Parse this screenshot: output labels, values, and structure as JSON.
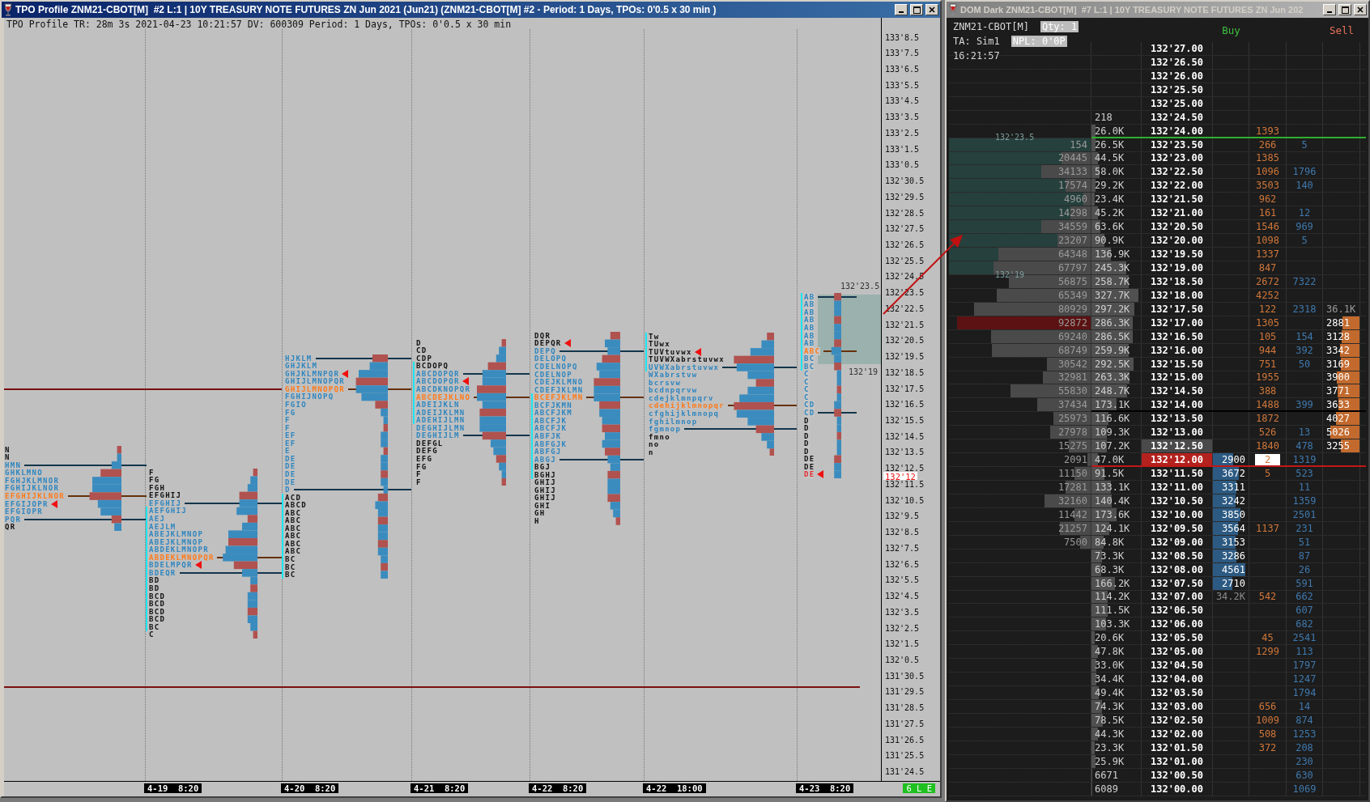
{
  "tpo_window": {
    "title": "TPO Profile ZNM21-CBOT[M]  #2 L:1 | 10Y TREASURY NOTE FUTURES ZN Jun 2021 (Jun21) (ZNM21-CBOT[M] #2 - Period: 1 Days, TPOs: 0'0.5 x 30 min )",
    "header": "TPO Profile TR: 28m 3s 2021-04-23 10:21:57 DV: 600309 Period: 1 Days, TPOs: 0'0.5 x 30 min",
    "price_axis": [
      "133'8.5",
      "133'7.5",
      "133'6.5",
      "133'5.5",
      "133'4.5",
      "133'3.5",
      "133'2.5",
      "133'1.5",
      "133'0.5",
      "132'30.5",
      "132'29.5",
      "132'28.5",
      "132'27.5",
      "132'26.5",
      "132'25.5",
      "132'24.5",
      "132'23.5",
      "132'22.5",
      "132'21.5",
      "132'20.5",
      "132'19.5",
      "132'18.5",
      "132'17.5",
      "132'16.5",
      "132'15.5",
      "132'14.5",
      "132'13.5",
      "132'12.5",
      "132'11.5",
      "132'10.5",
      "132'9.5",
      "132'8.5",
      "132'7.5",
      "132'6.5",
      "132'5.5",
      "132'4.5",
      "132'3.5",
      "132'2.5",
      "132'1.5",
      "132'0.5",
      "131'30.5",
      "131'29.5",
      "131'28.5",
      "131'27.5",
      "131'26.5",
      "131'25.5",
      "131'24.5"
    ],
    "last_price_label": "132'12",
    "value_area_labels": [
      "132'23.5",
      "132'19"
    ],
    "status": "6 L E",
    "sessions": [
      {
        "profile": [
          {
            "text": "N",
            "color": "#111111",
            "ib": false,
            "arrow": false,
            "line": false
          },
          {
            "text": "N",
            "color": "#111111",
            "ib": false,
            "arrow": false,
            "line": false
          },
          {
            "text": "HMN",
            "color": "#2f86bf",
            "ib": false,
            "arrow": false,
            "line": true
          },
          {
            "text": "GHKLMNO",
            "color": "#2f86bf",
            "ib": false,
            "arrow": false,
            "line": false
          },
          {
            "text": "FGHJKLMNOR",
            "color": "#2f86bf",
            "ib": false,
            "arrow": false,
            "line": false
          },
          {
            "text": "FGHIJKLNOR",
            "color": "#2f86bf",
            "ib": false,
            "arrow": false,
            "line": false
          },
          {
            "text": "EFGHIJKLNOR",
            "color": "#ff7a1a",
            "ib": false,
            "arrow": false,
            "line": true
          },
          {
            "text": "EFGIJOPR",
            "color": "#2f86bf",
            "ib": false,
            "arrow": true,
            "line": false
          },
          {
            "text": "EFGIOPR",
            "color": "#2f86bf",
            "ib": false,
            "arrow": false,
            "line": false
          },
          {
            "text": "PQR",
            "color": "#2f86bf",
            "ib": false,
            "arrow": false,
            "line": true
          },
          {
            "text": "QR",
            "color": "#111111",
            "ib": false,
            "arrow": false,
            "line": false
          }
        ]
      },
      {
        "date": "4-19  8:20",
        "profile": [
          {
            "text": "F",
            "color": "#111111",
            "ib": false,
            "arrow": false,
            "line": false
          },
          {
            "text": "FG",
            "color": "#111111",
            "ib": false,
            "arrow": false,
            "line": false
          },
          {
            "text": "FGH",
            "color": "#111111",
            "ib": false,
            "arrow": false,
            "line": false
          },
          {
            "text": "EFGHIJ",
            "color": "#111111",
            "ib": false,
            "arrow": false,
            "line": false
          },
          {
            "text": "EFGHIJ",
            "color": "#2f86bf",
            "ib": false,
            "arrow": false,
            "line": true
          },
          {
            "text": "AEFGHIJ",
            "color": "#2f86bf",
            "ib": true,
            "arrow": false,
            "line": false
          },
          {
            "text": "AEJ",
            "color": "#2f86bf",
            "ib": true,
            "arrow": false,
            "line": false
          },
          {
            "text": "AEJLM",
            "color": "#2f86bf",
            "ib": true,
            "arrow": false,
            "line": false
          },
          {
            "text": "ABEJKLMNOP",
            "color": "#2f86bf",
            "ib": true,
            "arrow": false,
            "line": false
          },
          {
            "text": "ABEJKLMNOP",
            "color": "#2f86bf",
            "ib": true,
            "arrow": false,
            "line": false
          },
          {
            "text": "ABDEKLMNOPR",
            "color": "#2f86bf",
            "ib": true,
            "arrow": false,
            "line": false
          },
          {
            "text": "ABDEKLMNOPQR",
            "color": "#ff7a1a",
            "ib": true,
            "arrow": false,
            "line": true
          },
          {
            "text": "BDELMPQR",
            "color": "#2f86bf",
            "ib": true,
            "arrow": true,
            "line": false
          },
          {
            "text": "BDEQR",
            "color": "#2f86bf",
            "ib": true,
            "arrow": false,
            "line": true
          },
          {
            "text": "BD",
            "color": "#111111",
            "ib": true,
            "arrow": false,
            "line": false
          },
          {
            "text": "BD",
            "color": "#111111",
            "ib": true,
            "arrow": false,
            "line": false
          },
          {
            "text": "BCD",
            "color": "#111111",
            "ib": true,
            "arrow": false,
            "line": false
          },
          {
            "text": "BCD",
            "color": "#111111",
            "ib": true,
            "arrow": false,
            "line": false
          },
          {
            "text": "BCD",
            "color": "#111111",
            "ib": true,
            "arrow": false,
            "line": false
          },
          {
            "text": "BCD",
            "color": "#111111",
            "ib": true,
            "arrow": false,
            "line": false
          },
          {
            "text": "BC",
            "color": "#111111",
            "ib": true,
            "arrow": false,
            "line": false
          },
          {
            "text": "C",
            "color": "#111111",
            "ib": false,
            "arrow": false,
            "line": false
          }
        ]
      },
      {
        "date": "4-20  8:20",
        "profile": [
          {
            "text": "HJKLM",
            "color": "#2f86bf",
            "ib": false,
            "arrow": false,
            "line": true
          },
          {
            "text": "GHJKLM",
            "color": "#2f86bf",
            "ib": false,
            "arrow": false,
            "line": false
          },
          {
            "text": "GHJKLMNPQR",
            "color": "#2f86bf",
            "ib": false,
            "arrow": true,
            "line": false
          },
          {
            "text": "GHIJLMNOPQR",
            "color": "#2f86bf",
            "ib": false,
            "arrow": false,
            "line": false
          },
          {
            "text": "GHIJLMNOPQR",
            "color": "#ff7a1a",
            "ib": false,
            "arrow": false,
            "line": true
          },
          {
            "text": "FGHIJNOPQ",
            "color": "#2f86bf",
            "ib": false,
            "arrow": false,
            "line": false
          },
          {
            "text": "FGIO",
            "color": "#2f86bf",
            "ib": false,
            "arrow": false,
            "line": false
          },
          {
            "text": "FG",
            "color": "#2f86bf",
            "ib": false,
            "arrow": false,
            "line": false
          },
          {
            "text": "F",
            "color": "#2f86bf",
            "ib": false,
            "arrow": false,
            "line": false
          },
          {
            "text": "F",
            "color": "#2f86bf",
            "ib": false,
            "arrow": false,
            "line": false
          },
          {
            "text": "EF",
            "color": "#2f86bf",
            "ib": false,
            "arrow": false,
            "line": false
          },
          {
            "text": "EF",
            "color": "#2f86bf",
            "ib": false,
            "arrow": false,
            "line": false
          },
          {
            "text": "E",
            "color": "#2f86bf",
            "ib": false,
            "arrow": false,
            "line": false
          },
          {
            "text": "DE",
            "color": "#2f86bf",
            "ib": false,
            "arrow": false,
            "line": false
          },
          {
            "text": "DE",
            "color": "#2f86bf",
            "ib": false,
            "arrow": false,
            "line": false
          },
          {
            "text": "DE",
            "color": "#2f86bf",
            "ib": false,
            "arrow": false,
            "line": false
          },
          {
            "text": "DE",
            "color": "#2f86bf",
            "ib": false,
            "arrow": false,
            "line": false
          },
          {
            "text": "D",
            "color": "#2f86bf",
            "ib": false,
            "arrow": false,
            "line": true
          },
          {
            "text": "ACD",
            "color": "#111111",
            "ib": true,
            "arrow": false,
            "line": false
          },
          {
            "text": "ABCD",
            "color": "#111111",
            "ib": true,
            "arrow": false,
            "line": false
          },
          {
            "text": "ABC",
            "color": "#111111",
            "ib": true,
            "arrow": false,
            "line": false
          },
          {
            "text": "ABC",
            "color": "#111111",
            "ib": true,
            "arrow": false,
            "line": false
          },
          {
            "text": "ABC",
            "color": "#111111",
            "ib": true,
            "arrow": false,
            "line": false
          },
          {
            "text": "ABC",
            "color": "#111111",
            "ib": true,
            "arrow": false,
            "line": false
          },
          {
            "text": "ABC",
            "color": "#111111",
            "ib": true,
            "arrow": false,
            "line": false
          },
          {
            "text": "ABC",
            "color": "#111111",
            "ib": true,
            "arrow": false,
            "line": false
          },
          {
            "text": "BC",
            "color": "#111111",
            "ib": true,
            "arrow": false,
            "line": false
          },
          {
            "text": "BC",
            "color": "#111111",
            "ib": true,
            "arrow": false,
            "line": false
          },
          {
            "text": "BC",
            "color": "#111111",
            "ib": true,
            "arrow": false,
            "line": false
          }
        ]
      },
      {
        "date": "4-21  8:20",
        "profile": [
          {
            "text": "D",
            "color": "#111111",
            "ib": false,
            "arrow": false,
            "line": false
          },
          {
            "text": "CD",
            "color": "#111111",
            "ib": false,
            "arrow": false,
            "line": false
          },
          {
            "text": "CDP",
            "color": "#111111",
            "ib": false,
            "arrow": false,
            "line": false
          },
          {
            "text": "BCDOPQ",
            "color": "#111111",
            "ib": true,
            "arrow": false,
            "line": false
          },
          {
            "text": "ABCDOPQR",
            "color": "#2f86bf",
            "ib": true,
            "arrow": false,
            "line": true
          },
          {
            "text": "ABCDOPQR",
            "color": "#2f86bf",
            "ib": true,
            "arrow": true,
            "line": false
          },
          {
            "text": "ABCDKNOPQR",
            "color": "#2f86bf",
            "ib": true,
            "arrow": false,
            "line": false
          },
          {
            "text": "ABCDEJKLNO",
            "color": "#ff7a1a",
            "ib": true,
            "arrow": false,
            "line": true
          },
          {
            "text": "ADEIJKLN",
            "color": "#2f86bf",
            "ib": true,
            "arrow": false,
            "line": false
          },
          {
            "text": "ADEIJKLMN",
            "color": "#2f86bf",
            "ib": true,
            "arrow": false,
            "line": false
          },
          {
            "text": "ADEHIJLMN",
            "color": "#2f86bf",
            "ib": true,
            "arrow": false,
            "line": false
          },
          {
            "text": "DEGHIJLMN",
            "color": "#2f86bf",
            "ib": false,
            "arrow": false,
            "line": false
          },
          {
            "text": "DEGHIJLM",
            "color": "#2f86bf",
            "ib": false,
            "arrow": false,
            "line": true
          },
          {
            "text": "DEFGL",
            "color": "#111111",
            "ib": false,
            "arrow": false,
            "line": false
          },
          {
            "text": "DEFG",
            "color": "#111111",
            "ib": false,
            "arrow": false,
            "line": false
          },
          {
            "text": "EFG",
            "color": "#111111",
            "ib": false,
            "arrow": false,
            "line": false
          },
          {
            "text": "FG",
            "color": "#111111",
            "ib": false,
            "arrow": false,
            "line": false
          },
          {
            "text": "F",
            "color": "#111111",
            "ib": false,
            "arrow": false,
            "line": false
          },
          {
            "text": "F",
            "color": "#111111",
            "ib": false,
            "arrow": false,
            "line": false
          }
        ]
      },
      {
        "date": "4-22  8:20",
        "profile": [
          {
            "text": "DQR",
            "color": "#111111",
            "ib": false,
            "arrow": false,
            "line": false
          },
          {
            "text": "DEPQR",
            "color": "#111111",
            "ib": false,
            "arrow": true,
            "line": false
          },
          {
            "text": "DEPQ",
            "color": "#2f86bf",
            "ib": false,
            "arrow": false,
            "line": true
          },
          {
            "text": "DELOPQ",
            "color": "#2f86bf",
            "ib": false,
            "arrow": false,
            "line": false
          },
          {
            "text": "CDELNOPQ",
            "color": "#2f86bf",
            "ib": false,
            "arrow": false,
            "line": false
          },
          {
            "text": "CDELNOP",
            "color": "#2f86bf",
            "ib": false,
            "arrow": false,
            "line": false
          },
          {
            "text": "CDEJKLMNO",
            "color": "#2f86bf",
            "ib": false,
            "arrow": false,
            "line": false
          },
          {
            "text": "CDEFJKLMN",
            "color": "#2f86bf",
            "ib": false,
            "arrow": false,
            "line": false
          },
          {
            "text": "BCEFJKLMN",
            "color": "#ff7a1a",
            "ib": true,
            "arrow": false,
            "line": true
          },
          {
            "text": "BCFJKMN",
            "color": "#2f86bf",
            "ib": true,
            "arrow": false,
            "line": false
          },
          {
            "text": "ABCFJKM",
            "color": "#2f86bf",
            "ib": true,
            "arrow": false,
            "line": false
          },
          {
            "text": "ABCFJK",
            "color": "#2f86bf",
            "ib": true,
            "arrow": false,
            "line": false
          },
          {
            "text": "ABCFJK",
            "color": "#2f86bf",
            "ib": true,
            "arrow": false,
            "line": false
          },
          {
            "text": "ABFJK",
            "color": "#2f86bf",
            "ib": true,
            "arrow": false,
            "line": false
          },
          {
            "text": "ABFGJK",
            "color": "#2f86bf",
            "ib": true,
            "arrow": false,
            "line": false
          },
          {
            "text": "ABFGJ",
            "color": "#2f86bf",
            "ib": true,
            "arrow": false,
            "line": false
          },
          {
            "text": "ABGJ",
            "color": "#2f86bf",
            "ib": true,
            "arrow": false,
            "line": true
          },
          {
            "text": "BGJ",
            "color": "#111111",
            "ib": true,
            "arrow": false,
            "line": false
          },
          {
            "text": "BGHJ",
            "color": "#111111",
            "ib": true,
            "arrow": false,
            "line": false
          },
          {
            "text": "GHIJ",
            "color": "#111111",
            "ib": false,
            "arrow": false,
            "line": false
          },
          {
            "text": "GHIJ",
            "color": "#111111",
            "ib": false,
            "arrow": false,
            "line": false
          },
          {
            "text": "GHIJ",
            "color": "#111111",
            "ib": false,
            "arrow": false,
            "line": false
          },
          {
            "text": "GHI",
            "color": "#111111",
            "ib": false,
            "arrow": false,
            "line": false
          },
          {
            "text": "GH",
            "color": "#111111",
            "ib": false,
            "arrow": false,
            "line": false
          },
          {
            "text": "H",
            "color": "#111111",
            "ib": false,
            "arrow": false,
            "line": false
          }
        ]
      },
      {
        "date": "4-22  18:00",
        "profile": [
          {
            "text": "Tw",
            "color": "#111111",
            "ib": true,
            "arrow": false,
            "line": false
          },
          {
            "text": "TUwx",
            "color": "#111111",
            "ib": true,
            "arrow": false,
            "line": false
          },
          {
            "text": "TUVtuvwx",
            "color": "#111111",
            "ib": true,
            "arrow": true,
            "line": false
          },
          {
            "text": "TUVWXabrstuvwx",
            "color": "#111111",
            "ib": true,
            "arrow": false,
            "line": false
          },
          {
            "text": "UVWXabrstuvwx",
            "color": "#2f86bf",
            "ib": true,
            "arrow": false,
            "line": true
          },
          {
            "text": "WXabrstvw",
            "color": "#2f86bf",
            "ib": false,
            "arrow": false,
            "line": false
          },
          {
            "text": "bcrsvw",
            "color": "#2f86bf",
            "ib": false,
            "arrow": false,
            "line": false
          },
          {
            "text": "bcdnpqrvw",
            "color": "#2f86bf",
            "ib": false,
            "arrow": false,
            "line": false
          },
          {
            "text": "cdejklmnpqrv",
            "color": "#2f86bf",
            "ib": false,
            "arrow": false,
            "line": false
          },
          {
            "text": "cdehijklmnopqr",
            "color": "#ff7a1a",
            "ib": false,
            "arrow": false,
            "line": true
          },
          {
            "text": "cfghijklmnopq",
            "color": "#2f86bf",
            "ib": false,
            "arrow": false,
            "line": false
          },
          {
            "text": "fghilmnop",
            "color": "#2f86bf",
            "ib": false,
            "arrow": false,
            "line": false
          },
          {
            "text": "fgmnop",
            "color": "#2f86bf",
            "ib": false,
            "arrow": false,
            "line": true
          },
          {
            "text": "fmno",
            "color": "#111111",
            "ib": false,
            "arrow": false,
            "line": false
          },
          {
            "text": "no",
            "color": "#111111",
            "ib": false,
            "arrow": false,
            "line": false
          },
          {
            "text": "n",
            "color": "#111111",
            "ib": false,
            "arrow": false,
            "line": false
          }
        ]
      },
      {
        "date": "4-23  8:20",
        "profile": [
          {
            "text": "AB",
            "color": "#2f86bf",
            "ib": true,
            "arrow": false,
            "line": true
          },
          {
            "text": "AB",
            "color": "#2f86bf",
            "ib": true,
            "arrow": false,
            "line": false
          },
          {
            "text": "AB",
            "color": "#2f86bf",
            "ib": true,
            "arrow": false,
            "line": false
          },
          {
            "text": "AB",
            "color": "#2f86bf",
            "ib": true,
            "arrow": false,
            "line": false
          },
          {
            "text": "AB",
            "color": "#2f86bf",
            "ib": true,
            "arrow": false,
            "line": false
          },
          {
            "text": "AB",
            "color": "#2f86bf",
            "ib": true,
            "arrow": false,
            "line": false
          },
          {
            "text": "AB",
            "color": "#2f86bf",
            "ib": true,
            "arrow": false,
            "line": false
          },
          {
            "text": "ABC",
            "color": "#ff7a1a",
            "ib": true,
            "arrow": false,
            "line": true
          },
          {
            "text": "BC",
            "color": "#2f86bf",
            "ib": true,
            "arrow": false,
            "line": false
          },
          {
            "text": "BC",
            "color": "#2f86bf",
            "ib": true,
            "arrow": false,
            "line": false
          },
          {
            "text": "C",
            "color": "#2f86bf",
            "ib": false,
            "arrow": false,
            "line": false
          },
          {
            "text": "C",
            "color": "#2f86bf",
            "ib": false,
            "arrow": false,
            "line": false
          },
          {
            "text": "C",
            "color": "#2f86bf",
            "ib": false,
            "arrow": false,
            "line": false
          },
          {
            "text": "C",
            "color": "#2f86bf",
            "ib": false,
            "arrow": false,
            "line": false
          },
          {
            "text": "CD",
            "color": "#2f86bf",
            "ib": false,
            "arrow": false,
            "line": false
          },
          {
            "text": "CD",
            "color": "#2f86bf",
            "ib": false,
            "arrow": false,
            "line": true
          },
          {
            "text": "D",
            "color": "#111111",
            "ib": false,
            "arrow": false,
            "line": false
          },
          {
            "text": "D",
            "color": "#111111",
            "ib": false,
            "arrow": false,
            "line": false
          },
          {
            "text": "D",
            "color": "#111111",
            "ib": false,
            "arrow": false,
            "line": false
          },
          {
            "text": "D",
            "color": "#111111",
            "ib": false,
            "arrow": false,
            "line": false
          },
          {
            "text": "D",
            "color": "#111111",
            "ib": false,
            "arrow": false,
            "line": false
          },
          {
            "text": "DE",
            "color": "#111111",
            "ib": false,
            "arrow": false,
            "line": false
          },
          {
            "text": "DE",
            "color": "#111111",
            "ib": false,
            "arrow": false,
            "line": false
          },
          {
            "text": "DE",
            "color": "#e23030",
            "ib": false,
            "arrow": true,
            "line": false
          }
        ]
      }
    ]
  },
  "dom_window": {
    "title": "DOM Dark ZNM21-CBOT[M]  #7 L:1 | 10Y TREASURY NOTE FUTURES ZN Jun 202",
    "symbol": "ZNM21-CBOT[M]",
    "qty": "Qty: 1",
    "account": "TA: Sim1",
    "npl": "NPL: 0'0P",
    "time": "16:21:57",
    "buy_header": "Buy",
    "sell_header": "Sell",
    "value_area_labels": [
      "132'23.5",
      "132'19"
    ],
    "rows": [
      {
        "price": "132'27.00",
        "last": false,
        "previous": false
      },
      {
        "price": "132'26.50",
        "last": false,
        "previous": false
      },
      {
        "price": "132'26.00",
        "last": false,
        "previous": false
      },
      {
        "price": "132'25.50",
        "last": false,
        "previous": false
      },
      {
        "price": "132'25.00",
        "last": false,
        "previous": false
      },
      {
        "price": "132'24.50",
        "volume": "218",
        "last": false,
        "previous": false
      },
      {
        "price": "132'24.00",
        "volume": "26.0K",
        "column_5": "1393",
        "order_box": false,
        "last": false,
        "previous": false,
        "divider": {
          "color": "#2fb02f"
        }
      },
      {
        "price": "132'23.50",
        "profile_volume": "154",
        "value_area": true,
        "poc": false,
        "volume": "26.5K",
        "column_5": "266",
        "order_box": false,
        "column_6": "5",
        "last": false,
        "previous": false
      },
      {
        "price": "132'23.00",
        "profile_volume": "20445",
        "value_area": true,
        "poc": false,
        "volume": "44.5K",
        "column_5": "1385",
        "order_box": false,
        "last": false,
        "previous": false
      },
      {
        "price": "132'22.50",
        "profile_volume": "34133",
        "value_area": true,
        "poc": false,
        "volume": "58.0K",
        "column_5": "1096",
        "order_box": false,
        "column_6": "1796",
        "last": false,
        "previous": false
      },
      {
        "price": "132'22.00",
        "profile_volume": "17574",
        "value_area": true,
        "poc": false,
        "volume": "29.2K",
        "column_5": "3503",
        "order_box": false,
        "column_6": "140",
        "last": false,
        "previous": false
      },
      {
        "price": "132'21.50",
        "profile_volume": "4960",
        "value_area": true,
        "poc": false,
        "volume": "23.4K",
        "column_5": "962",
        "order_box": false,
        "last": false,
        "previous": false
      },
      {
        "price": "132'21.00",
        "profile_volume": "14298",
        "value_area": true,
        "poc": false,
        "volume": "45.2K",
        "column_5": "161",
        "order_box": false,
        "column_6": "12",
        "last": false,
        "previous": false
      },
      {
        "price": "132'20.50",
        "profile_volume": "34559",
        "value_area": true,
        "poc": false,
        "volume": "63.6K",
        "column_5": "1546",
        "order_box": false,
        "column_6": "969",
        "last": false,
        "previous": false
      },
      {
        "price": "132'20.00",
        "profile_volume": "23207",
        "value_area": true,
        "poc": false,
        "volume": "90.9K",
        "column_5": "1098",
        "order_box": false,
        "column_6": "5",
        "last": false,
        "previous": false
      },
      {
        "price": "132'19.50",
        "profile_volume": "64348",
        "value_area": true,
        "poc": false,
        "volume": "136.9K",
        "column_5": "1337",
        "order_box": false,
        "last": false,
        "previous": false
      },
      {
        "price": "132'19.00",
        "profile_volume": "67797",
        "value_area": true,
        "poc": false,
        "volume": "245.3K",
        "column_5": "847",
        "order_box": false,
        "last": false,
        "previous": false
      },
      {
        "price": "132'18.50",
        "profile_volume": "56875",
        "value_area": false,
        "poc": false,
        "volume": "258.7K",
        "column_5": "2672",
        "order_box": false,
        "column_6": "7322",
        "last": false,
        "previous": false
      },
      {
        "price": "132'18.00",
        "profile_volume": "65349",
        "value_area": false,
        "poc": false,
        "volume": "327.7K",
        "column_5": "4252",
        "order_box": false,
        "last": false,
        "previous": false
      },
      {
        "price": "132'17.50",
        "profile_volume": "80929",
        "value_area": false,
        "poc": false,
        "volume": "297.2K",
        "column_5": "122",
        "order_box": false,
        "column_6": "2318",
        "sell_total": "36.1K",
        "last": false,
        "previous": false
      },
      {
        "price": "132'17.00",
        "profile_volume": "92872",
        "value_area": false,
        "poc": true,
        "volume": "286.3K",
        "column_5": "1305",
        "order_box": false,
        "sell": "2881",
        "last": false,
        "previous": false
      },
      {
        "price": "132'16.50",
        "profile_volume": "69240",
        "value_area": false,
        "poc": false,
        "volume": "286.5K",
        "column_5": "105",
        "order_box": false,
        "column_6": "154",
        "sell": "3128",
        "last": false,
        "previous": false
      },
      {
        "price": "132'16.00",
        "profile_volume": "68749",
        "value_area": false,
        "poc": false,
        "volume": "259.9K",
        "column_5": "944",
        "order_box": false,
        "column_6": "392",
        "sell": "3342",
        "last": false,
        "previous": false
      },
      {
        "price": "132'15.50",
        "profile_volume": "30542",
        "value_area": false,
        "poc": false,
        "volume": "292.5K",
        "column_5": "751",
        "order_box": false,
        "column_6": "50",
        "sell": "3169",
        "last": false,
        "previous": false
      },
      {
        "price": "132'15.00",
        "profile_volume": "32981",
        "value_area": false,
        "poc": false,
        "volume": "263.3K",
        "column_5": "1955",
        "order_box": false,
        "sell": "3900",
        "last": false,
        "previous": false
      },
      {
        "price": "132'14.50",
        "profile_volume": "55830",
        "value_area": false,
        "poc": false,
        "volume": "248.7K",
        "column_5": "388",
        "order_box": false,
        "sell": "3771",
        "last": false,
        "previous": false
      },
      {
        "price": "132'14.00",
        "profile_volume": "37434",
        "value_area": false,
        "poc": false,
        "volume": "173.1K",
        "column_5": "1488",
        "order_box": false,
        "column_6": "399",
        "sell": "3633",
        "last": false,
        "previous": false,
        "divider": {
          "color": "#000000"
        }
      },
      {
        "price": "132'13.50",
        "profile_volume": "25973",
        "value_area": false,
        "poc": false,
        "volume": "116.6K",
        "column_5": "1872",
        "order_box": false,
        "sell": "4027",
        "last": false,
        "previous": false
      },
      {
        "price": "132'13.00",
        "profile_volume": "27978",
        "value_area": false,
        "poc": false,
        "volume": "109.3K",
        "column_5": "526",
        "order_box": false,
        "column_6": "13",
        "sell": "5026",
        "last": false,
        "previous": false
      },
      {
        "price": "132'12.50",
        "profile_volume": "15275",
        "value_area": false,
        "poc": false,
        "volume": "107.2K",
        "column_5": "1840",
        "order_box": false,
        "column_6": "478",
        "sell": "3255",
        "last": false,
        "previous": true
      },
      {
        "price": "132'12.00",
        "profile_volume": "2091",
        "value_area": false,
        "poc": false,
        "volume": "47.0K",
        "buy": "2900",
        "column_5": "2",
        "order_box": true,
        "column_6": "1319",
        "last": true,
        "previous": false,
        "divider": {
          "color": "#c01818"
        }
      },
      {
        "price": "132'11.50",
        "profile_volume": "11150",
        "value_area": false,
        "poc": false,
        "volume": "91.5K",
        "buy": "3672",
        "column_5": "5",
        "order_box": false,
        "column_6": "523",
        "last": false,
        "previous": false
      },
      {
        "price": "132'11.00",
        "profile_volume": "17281",
        "value_area": false,
        "poc": false,
        "volume": "133.1K",
        "buy": "3311",
        "column_6": "11",
        "last": false,
        "previous": false
      },
      {
        "price": "132'10.50",
        "profile_volume": "32160",
        "value_area": false,
        "poc": false,
        "volume": "140.4K",
        "buy": "3242",
        "column_6": "1359",
        "last": false,
        "previous": false
      },
      {
        "price": "132'10.00",
        "profile_volume": "11442",
        "value_area": false,
        "poc": false,
        "volume": "173.6K",
        "buy": "3850",
        "column_6": "2501",
        "last": false,
        "previous": false
      },
      {
        "price": "132'09.50",
        "profile_volume": "21257",
        "value_area": false,
        "poc": false,
        "volume": "124.1K",
        "buy": "3564",
        "column_5": "1137",
        "order_box": false,
        "column_6": "231",
        "last": false,
        "previous": false
      },
      {
        "price": "132'09.00",
        "profile_volume": "7500",
        "value_area": false,
        "poc": false,
        "volume": "84.8K",
        "buy": "3153",
        "column_6": "51",
        "last": false,
        "previous": false
      },
      {
        "price": "132'08.50",
        "volume": "73.3K",
        "buy": "3286",
        "column_6": "87",
        "last": false,
        "previous": false
      },
      {
        "price": "132'08.00",
        "volume": "68.3K",
        "buy": "4561",
        "column_6": "26",
        "last": false,
        "previous": false
      },
      {
        "price": "132'07.50",
        "volume": "166.2K",
        "buy": "2710",
        "column_6": "591",
        "last": false,
        "previous": false
      },
      {
        "price": "132'07.00",
        "volume": "114.2K",
        "buy_total": "34.2K",
        "column_5": "542",
        "order_box": false,
        "column_6": "662",
        "last": false,
        "previous": false
      },
      {
        "price": "132'06.50",
        "volume": "111.5K",
        "column_6": "607",
        "last": false,
        "previous": false
      },
      {
        "price": "132'06.00",
        "volume": "103.3K",
        "column_6": "682",
        "last": false,
        "previous": false
      },
      {
        "price": "132'05.50",
        "volume": "20.6K",
        "column_5": "45",
        "order_box": false,
        "column_6": "2541",
        "last": false,
        "previous": false
      },
      {
        "price": "132'05.00",
        "volume": "47.8K",
        "column_5": "1299",
        "order_box": false,
        "column_6": "113",
        "last": false,
        "previous": false
      },
      {
        "price": "132'04.50",
        "volume": "33.0K",
        "column_6": "1797",
        "last": false,
        "previous": false
      },
      {
        "price": "132'04.00",
        "volume": "34.4K",
        "column_6": "1247",
        "last": false,
        "previous": false
      },
      {
        "price": "132'03.50",
        "volume": "49.4K",
        "column_6": "1794",
        "last": false,
        "previous": false
      },
      {
        "price": "132'03.00",
        "volume": "74.3K",
        "column_5": "656",
        "order_box": false,
        "column_6": "14",
        "last": false,
        "previous": false
      },
      {
        "price": "132'02.50",
        "volume": "78.5K",
        "column_5": "1009",
        "order_box": false,
        "column_6": "874",
        "last": false,
        "previous": false
      },
      {
        "price": "132'02.00",
        "volume": "44.3K",
        "column_5": "508",
        "order_box": false,
        "column_6": "1253",
        "last": false,
        "previous": false
      },
      {
        "price": "132'01.50",
        "volume": "23.3K",
        "column_5": "372",
        "order_box": false,
        "column_6": "208",
        "last": false,
        "previous": false
      },
      {
        "price": "132'01.00",
        "volume": "25.9K",
        "column_6": "230",
        "last": false,
        "previous": false
      },
      {
        "price": "132'00.50",
        "volume": "6671",
        "column_6": "630",
        "last": false,
        "previous": false
      },
      {
        "price": "132'00.00",
        "volume": "6089",
        "column_6": "1069",
        "last": false,
        "previous": false
      }
    ]
  }
}
